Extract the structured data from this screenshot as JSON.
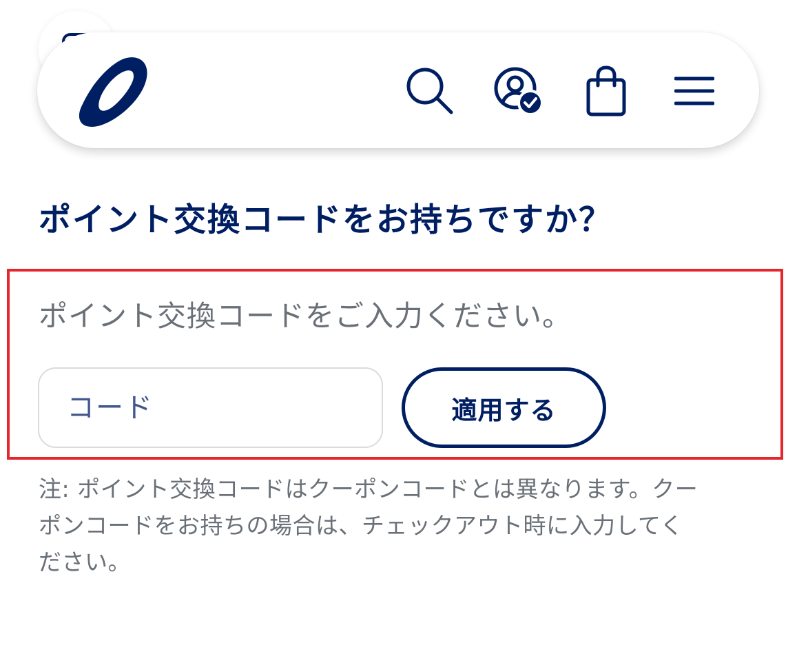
{
  "header": {
    "brand_logo": "asics-logo",
    "brand_color": "#001e62",
    "icons": [
      "search-icon",
      "account-verified-icon",
      "shopping-bag-icon",
      "hamburger-menu-icon"
    ]
  },
  "main": {
    "title": "ポイント交換コードをお持ちですか？",
    "prompt": "ポイント交換コードをご入力ください。",
    "code_input": {
      "value": "",
      "placeholder": "コード"
    },
    "apply_button_label": "適用する",
    "note_line1": "注: ポイント交換コードはクーポンコードとは異なります。クー",
    "note_line2": "ポンコードをお持ちの場合は、チェックアウト時に入力してく",
    "note_line3": "ださい。"
  },
  "colors": {
    "accent": "#001e62",
    "highlight": "#e5262c",
    "muted_text": "#6a7078",
    "input_border": "#d9dbe0"
  }
}
